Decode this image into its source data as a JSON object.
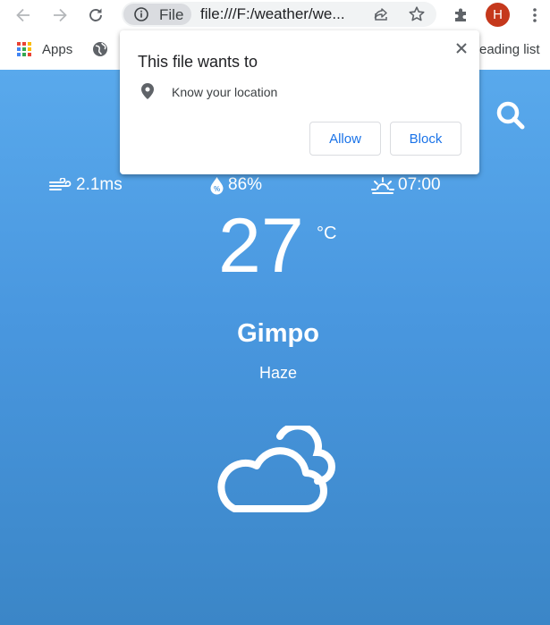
{
  "browser": {
    "site_chip_label": "File",
    "url": "file:///F:/weather/we...",
    "avatar_letter": "H",
    "avatar_color": "#c5381c",
    "bookmarks": {
      "apps_label": "Apps",
      "reading_list_label": "eading list"
    }
  },
  "permission_popup": {
    "title": "This file wants to",
    "item": "Know your location",
    "allow_label": "Allow",
    "block_label": "Block",
    "button_text_color": "#1a73e8"
  },
  "weather": {
    "wind": "2.1ms",
    "humidity": "86%",
    "sunrise": "07:00",
    "temperature": "27",
    "unit": "°C",
    "city": "Gimpo",
    "condition": "Haze",
    "condition_icon": "cloud-icon",
    "background_top": "#59a9ec",
    "background_bottom": "#3b86c7"
  }
}
